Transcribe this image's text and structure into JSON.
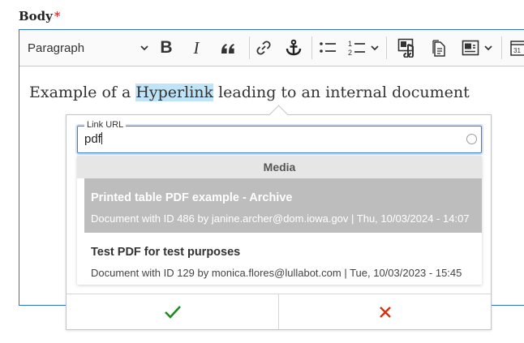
{
  "field": {
    "label": "Body",
    "required_mark": "*"
  },
  "toolbar": {
    "heading_select": "Paragraph",
    "buttons": [
      {
        "icon": "bold-icon",
        "label": "B"
      },
      {
        "icon": "italic-icon",
        "label": "I"
      },
      {
        "icon": "blockquote-icon"
      },
      {
        "icon": "link-icon"
      },
      {
        "icon": "anchor-icon"
      },
      {
        "icon": "bulleted-list-icon"
      },
      {
        "icon": "numbered-list-icon"
      },
      {
        "icon": "insert-media-icon"
      },
      {
        "icon": "document-icon"
      },
      {
        "icon": "image-align-icon"
      },
      {
        "icon": "calendar-icon"
      }
    ]
  },
  "content": {
    "before": "Example of a ",
    "highlighted": "Hyperlink",
    "after": " leading to an internal document"
  },
  "link_balloon": {
    "url_label": "Link URL",
    "url_value": "pdf",
    "group_header": "Media",
    "results": [
      {
        "title": "Printed table PDF example - Archive",
        "meta": "Document with ID 486 by janine.archer@dom.iowa.gov | Thu, 10/03/2024 - 14:07",
        "selected": true
      },
      {
        "title": "Test PDF for test purposes",
        "meta": "Document with ID 129 by monica.flores@lullabot.com | Tue, 10/03/2023 - 15:45",
        "selected": false
      }
    ],
    "save_icon": "checkmark-icon",
    "cancel_icon": "close-icon"
  },
  "colors": {
    "accent": "#2f6fd6",
    "selection_highlight": "#bfe3f7",
    "selected_row": "#bdbdbd",
    "save": "#1f8a23",
    "cancel": "#d6300e",
    "required": "#c21c1c"
  }
}
